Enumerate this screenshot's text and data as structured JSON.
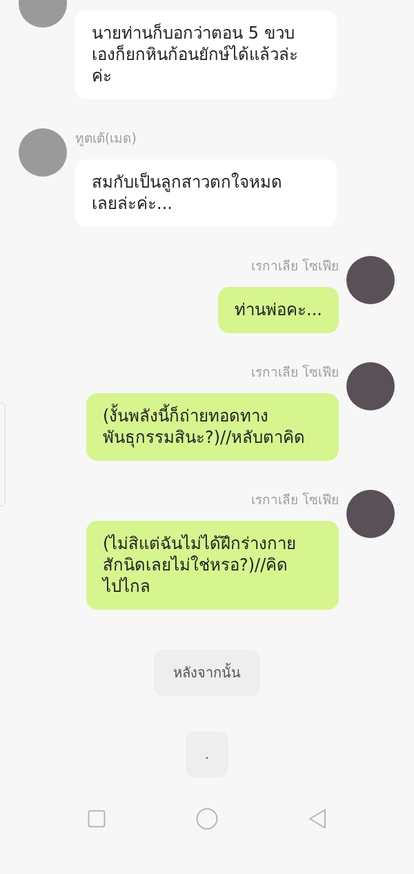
{
  "messages": [
    {
      "kind": "incoming",
      "lines": [
        "นายท่านก็บอกว่าตอน 5 ขวบ",
        "เองก็ยกหินก้อนยักษ์ได้แล้วล่ะ",
        "ค่ะ"
      ]
    },
    {
      "kind": "incoming",
      "sender": "ทูตเต้(เมด)",
      "lines": [
        "สมกับเป็นลูกสาวตกใจหมด",
        "เลยล่ะค่ะ..."
      ]
    },
    {
      "kind": "outgoing",
      "sender": "เรกาเลีย โซเฟีย",
      "lines": [
        "ท่านพ่อคะ..."
      ]
    },
    {
      "kind": "outgoing",
      "sender": "เรกาเลีย โซเฟีย",
      "lines": [
        "(งั้นพลังนี้ก็ถ่ายทอดทาง",
        "พันธุกรรมสินะ?)//หลับตาคิด"
      ]
    },
    {
      "kind": "outgoing",
      "sender": "เรกาเลีย โซเฟีย",
      "lines": [
        "(ไม่สิแต่ฉันไม่ได้ฝึกร่างกาย",
        "สักนิดเลยไม่ใช่หรอ?)//คิด",
        "ไปไกล"
      ]
    },
    {
      "kind": "option",
      "lines": [
        "หลังจากนั้น"
      ]
    },
    {
      "kind": "option",
      "lines": [
        "."
      ]
    }
  ]
}
